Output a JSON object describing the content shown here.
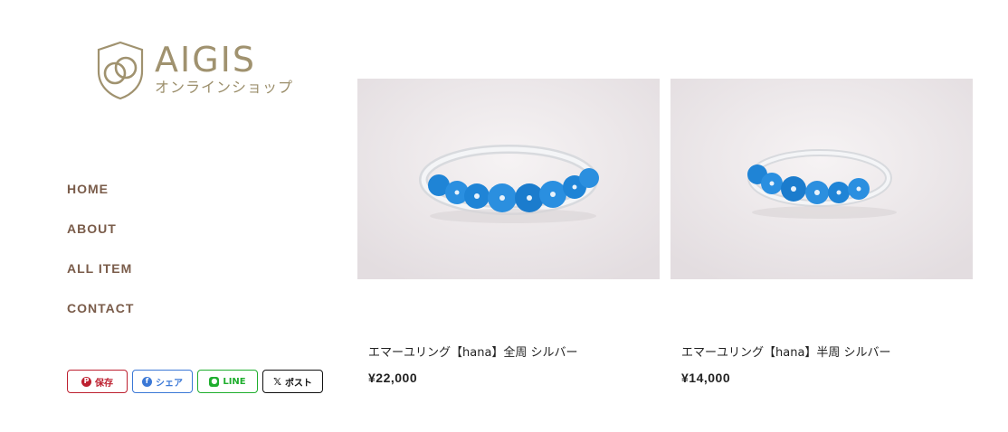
{
  "brand": {
    "name": "AIGIS",
    "tagline": "オンラインショップ",
    "logo_icon": "shield-rings-icon",
    "colors": {
      "logo": "#a0926f",
      "nav": "#7a5c4a"
    }
  },
  "nav": {
    "items": [
      {
        "label": "HOME"
      },
      {
        "label": "ABOUT"
      },
      {
        "label": "ALL ITEM"
      },
      {
        "label": "CONTACT"
      }
    ]
  },
  "share": {
    "pinterest": {
      "label": "保存",
      "icon": "pinterest-icon",
      "color": "#bd2030"
    },
    "facebook": {
      "label": "シェア",
      "icon": "facebook-icon",
      "color": "#3b78d6"
    },
    "line": {
      "label": "LINE",
      "icon": "line-icon",
      "color": "#1fae2e"
    },
    "x": {
      "label": "ポスト",
      "icon": "x-icon",
      "color": "#111111"
    }
  },
  "products": [
    {
      "name": "エマーユリング【hana】全周 シルバー",
      "price": "¥22,000"
    },
    {
      "name": "エマーユリング【hana】半周 シルバー",
      "price": "¥14,000"
    }
  ]
}
